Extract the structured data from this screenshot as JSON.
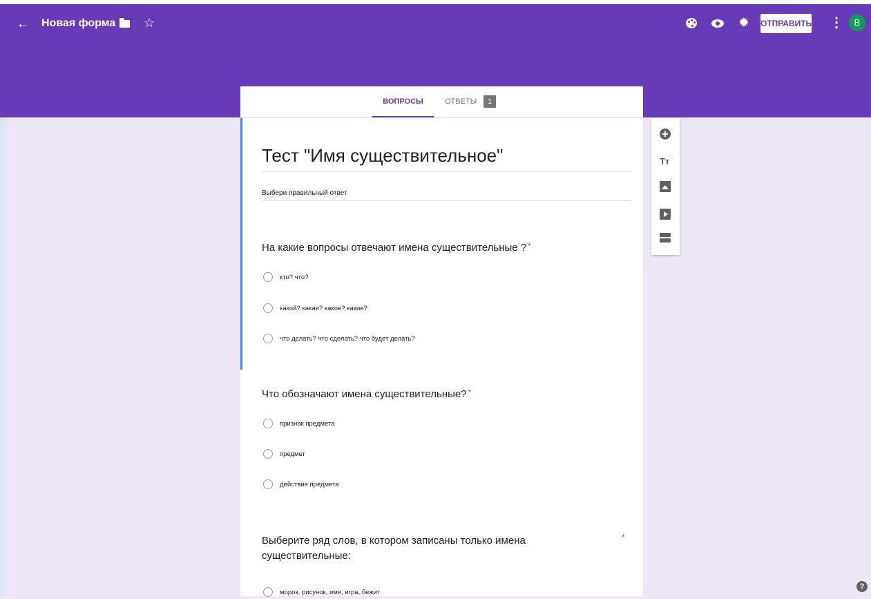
{
  "header": {
    "back_icon": "←",
    "title": "Новая форма",
    "star_icon": "☆",
    "gear_icon": "✹",
    "send_label": "ОТПРАВИТЬ",
    "more_icon": "⋮",
    "avatar_letter": "B",
    "colors": {
      "brand": "#673ab7",
      "avatar": "#0f9d58"
    }
  },
  "tabs": {
    "questions": "ВОПРОСЫ",
    "answers": "ОТВЕТЫ",
    "answers_count": "1"
  },
  "form": {
    "title": "Тест \"Имя существительное\"",
    "description": "Выбери правильный ответ",
    "required_mark": "*",
    "questions": [
      {
        "text": "На какие вопросы  отвечают имена существительные ?",
        "options": [
          "кто? что?",
          "какой? какая? какое? какие?",
          "что делать? что сделать? что будет делать?"
        ]
      },
      {
        "text": "Что обозначают имена существительные?",
        "options": [
          "признак предмета",
          "предмет",
          "действие предмета"
        ]
      },
      {
        "text": "Выберите ряд слов, в котором записаны только имена существительные:",
        "options": [
          "мороз, рисунок, имя, игра, бежит"
        ]
      }
    ]
  },
  "side_toolbar": {
    "title_text_icon": "Tт"
  },
  "help_icon": "?"
}
